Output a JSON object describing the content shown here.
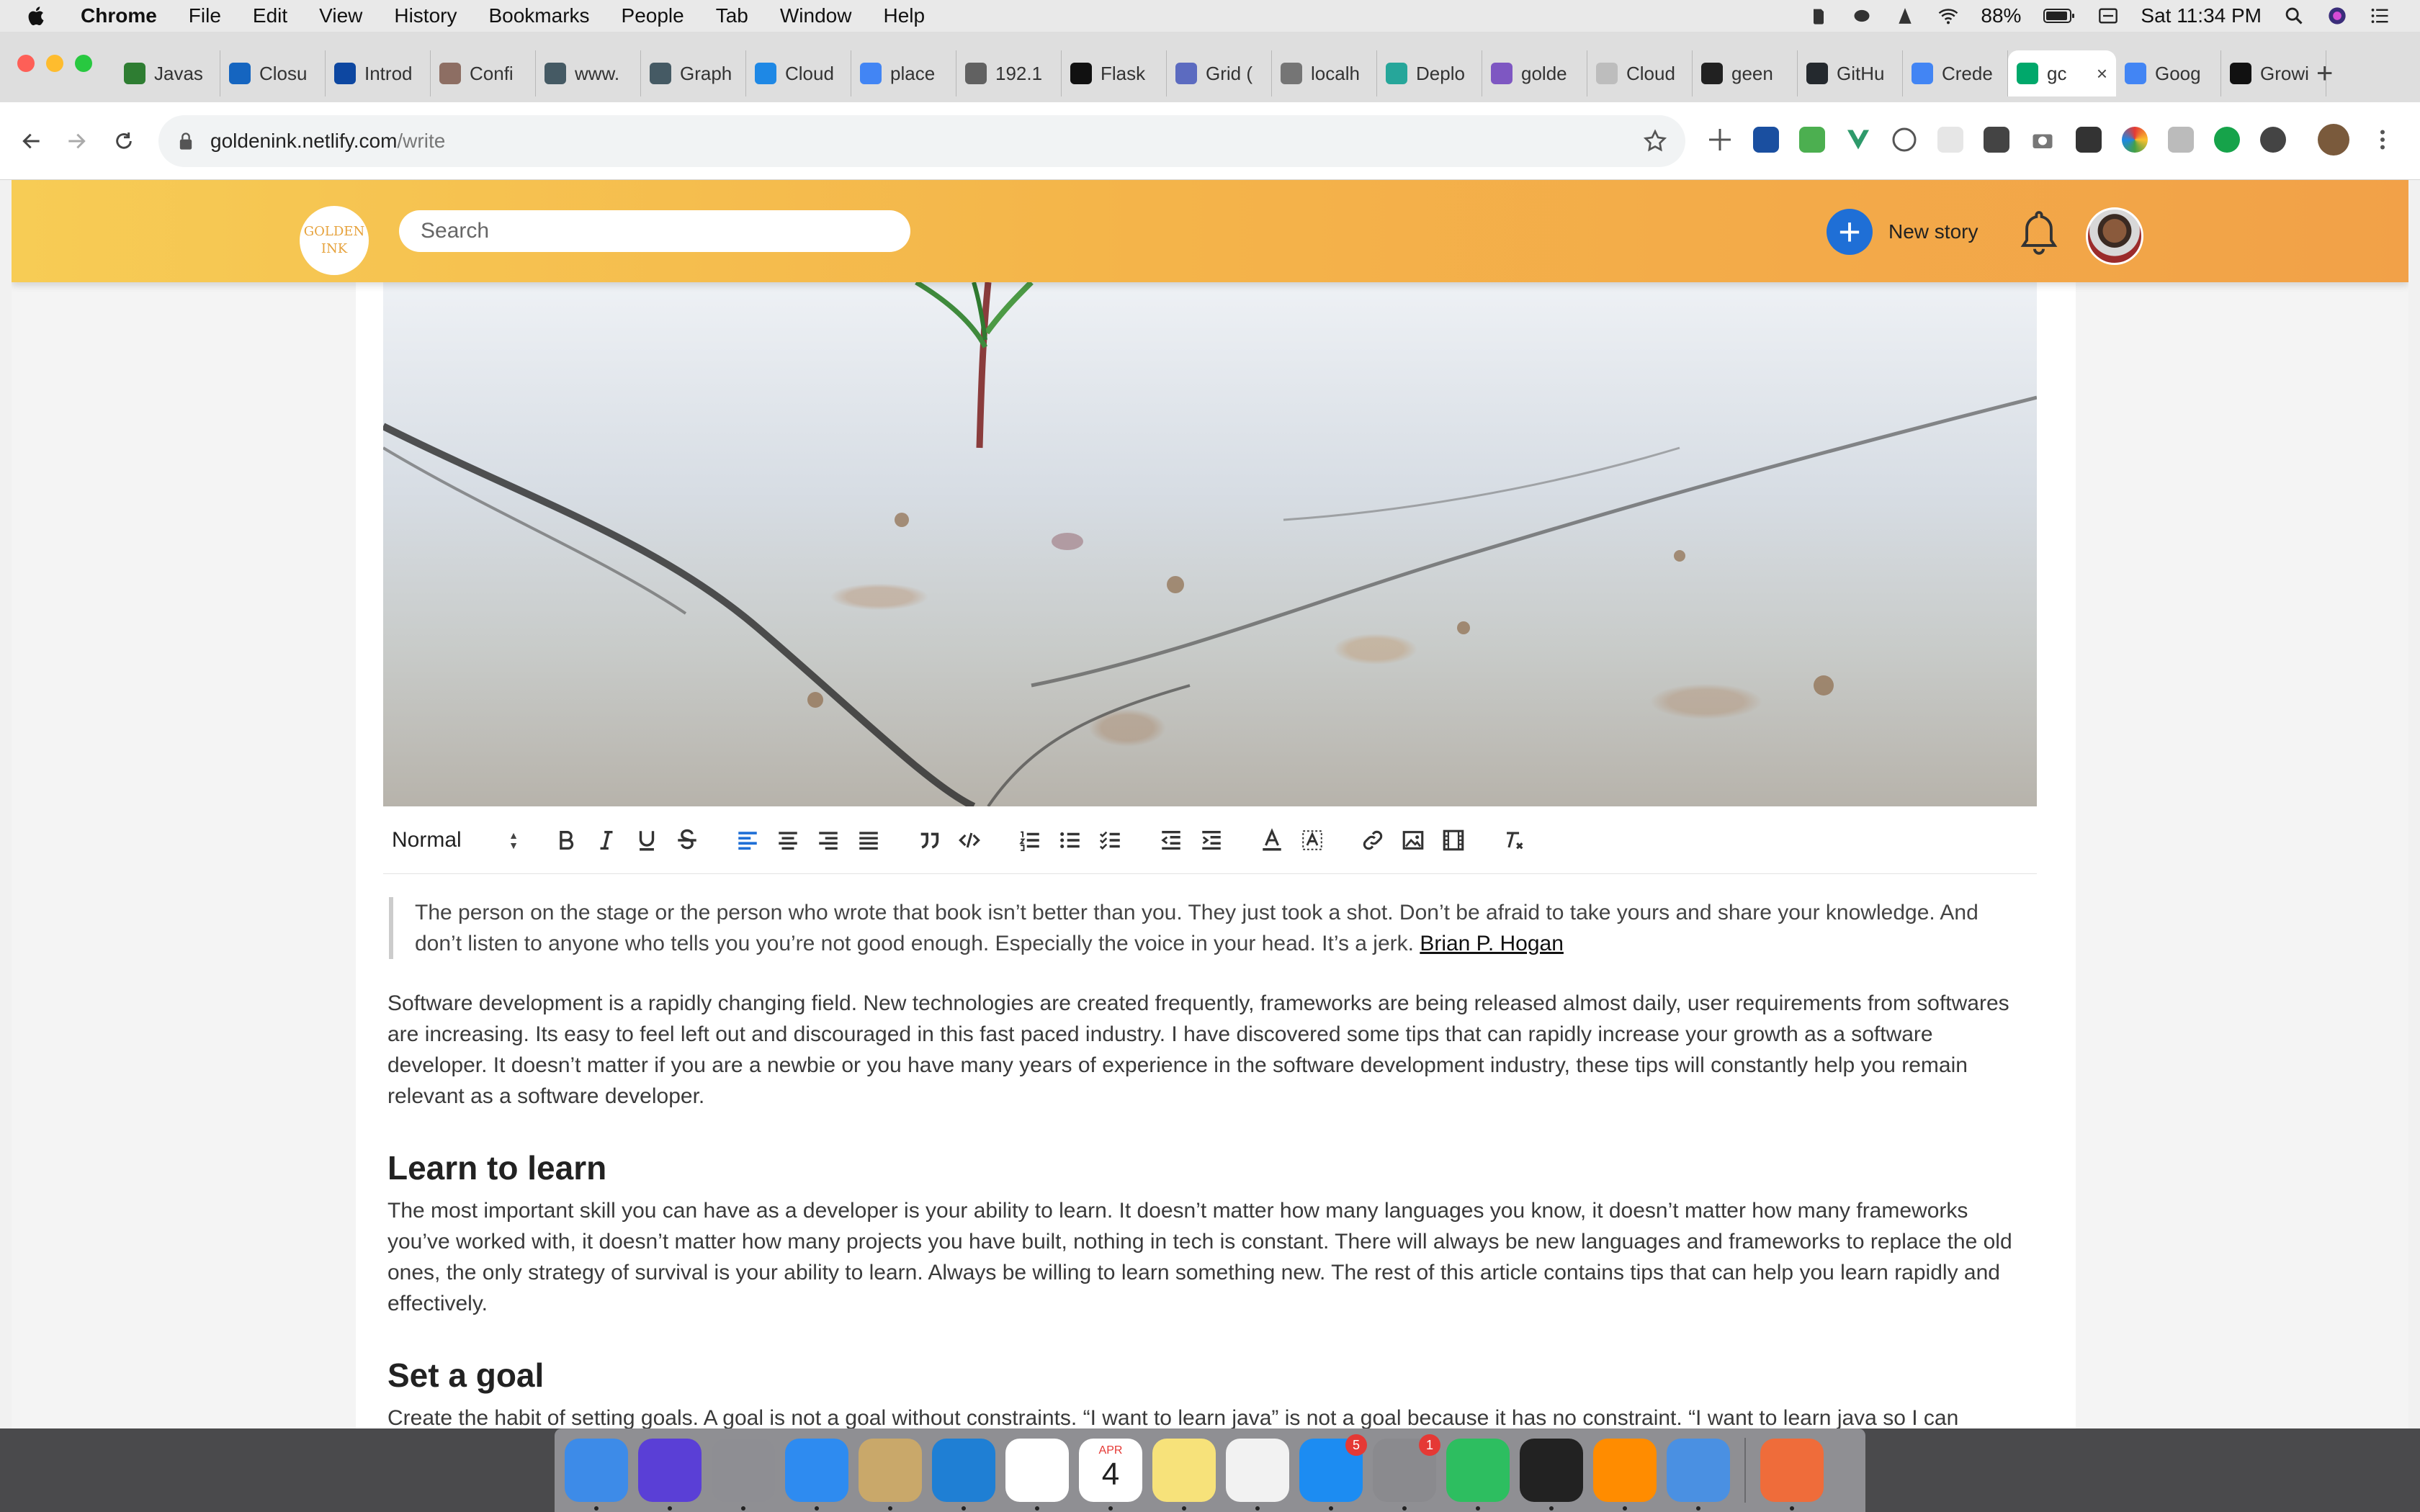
{
  "menubar": {
    "items": [
      "Chrome",
      "File",
      "Edit",
      "View",
      "History",
      "Bookmarks",
      "People",
      "Tab",
      "Window",
      "Help"
    ],
    "battery": "88%",
    "clock": "Sat 11:34 PM"
  },
  "tabs": [
    {
      "label": "Javas",
      "icon": "code-logo-icon",
      "color": "#2e7d32"
    },
    {
      "label": "Closu",
      "icon": "closure-icon",
      "color": "#1565c0"
    },
    {
      "label": "Introd",
      "icon": "intro-icon",
      "color": "#0d47a1"
    },
    {
      "label": "Confi",
      "icon": "fox-icon",
      "color": "#8d6e63"
    },
    {
      "label": "www.",
      "icon": "droplet-icon",
      "color": "#455a64"
    },
    {
      "label": "Graph",
      "icon": "droplet-icon",
      "color": "#455a64"
    },
    {
      "label": "Cloud",
      "icon": "cloud-house-icon",
      "color": "#1e88e5"
    },
    {
      "label": "place",
      "icon": "google-icon",
      "color": "#4285f4"
    },
    {
      "label": "192.1",
      "icon": "globe-icon",
      "color": "#616161"
    },
    {
      "label": "Flask",
      "icon": "dev-icon",
      "color": "#111111"
    },
    {
      "label": "Grid (",
      "icon": "wave-icon",
      "color": "#5c6bc0"
    },
    {
      "label": "localh",
      "icon": "v-icon",
      "color": "#757575"
    },
    {
      "label": "Deplo",
      "icon": "diamond-icon",
      "color": "#26a69a"
    },
    {
      "label": "golde",
      "icon": "h-icon",
      "color": "#7e57c2"
    },
    {
      "label": "Cloud",
      "icon": "cloud-icon",
      "color": "#bdbdbd"
    },
    {
      "label": "geen",
      "icon": "doc-icon",
      "color": "#212121"
    },
    {
      "label": "GitHu",
      "icon": "github-icon",
      "color": "#24292e"
    },
    {
      "label": "Crede",
      "icon": "google-icon",
      "color": "#4285f4"
    },
    {
      "label": "gc",
      "icon": "v-icon",
      "color": "#00a86b",
      "active": true
    },
    {
      "label": "Goog",
      "icon": "google-icon",
      "color": "#4285f4"
    },
    {
      "label": "Growi",
      "icon": "grow-icon",
      "color": "#111111"
    }
  ],
  "address": {
    "host": "goldenink.netlify.com",
    "path": "/write"
  },
  "app": {
    "logo_line1": "GOLDEN",
    "logo_line2": "INK",
    "search_placeholder": "Search",
    "new_story": "New story"
  },
  "editor_toolbar": {
    "format": "Normal"
  },
  "article": {
    "quote": "The person on the stage or the person who wrote that book isn’t better than you. They just took a shot. Don’t be afraid to take yours and share your knowledge. And don’t listen to anyone who tells you you’re not good enough. Especially the voice in your head. It’s a jerk. ",
    "quote_author": "Brian P. Hogan",
    "intro": "Software development is a rapidly changing field. New technologies are created frequently, frameworks are being released almost daily, user requirements from softwares are increasing. Its easy to feel left out and discouraged in this fast paced industry. I have discovered some tips that can rapidly increase your growth as a software developer. It doesn’t matter if you are a newbie or you have many years of experience in the software development industry, these tips will constantly help you remain relevant as a software developer.",
    "h_learn": "Learn to learn",
    "p_learn": "The most important skill you can have as a developer is your ability to learn. It doesn’t matter how many languages you know, it doesn’t matter how many frameworks you’ve worked with, it doesn’t matter how many projects you have built, nothing in tech is constant. There will always be new languages and frameworks to replace the old ones, the only strategy of survival is your ability to learn. Always be willing to learn something new. The rest of this article contains tips that can help you learn rapidly and effectively.",
    "h_goal": "Set a goal",
    "p_goal": "Create the habit of setting goals. A goal is not a goal without constraints. “I want to learn java” is not a goal because it has no constraint. “I want to learn java so I can develop XYZ software” or “I want to learn java for my school project” is a goal. A goal should be definite and must have a constraint. Set a goal, make a plan, write it down, set a"
  },
  "dock": {
    "apps": [
      {
        "name": "finder-icon",
        "color": "#3d8be8"
      },
      {
        "name": "siri-icon",
        "color": "#5a3fd6"
      },
      {
        "name": "launchpad-icon",
        "color": "#8e8e93"
      },
      {
        "name": "safari-icon",
        "color": "#2e8bf0"
      },
      {
        "name": "preview-icon",
        "color": "#c9a86a"
      },
      {
        "name": "vscode-icon",
        "color": "#1f7fd4"
      },
      {
        "name": "chrome-icon",
        "color": "#ffffff"
      },
      {
        "name": "calendar-icon",
        "color": "#ffffff"
      },
      {
        "name": "notes-icon",
        "color": "#f7e27a"
      },
      {
        "name": "music-icon",
        "color": "#f2f2f2"
      },
      {
        "name": "appstore-icon",
        "color": "#1c8cf2",
        "badge": "5"
      },
      {
        "name": "system-preferences-icon",
        "color": "#8a8a8e",
        "badge": "1"
      },
      {
        "name": "evernote-icon",
        "color": "#2dbe60"
      },
      {
        "name": "terminal-icon",
        "color": "#222222"
      },
      {
        "name": "vlc-icon",
        "color": "#ff8c00"
      },
      {
        "name": "tableplus-icon",
        "color": "#4a90e2"
      },
      {
        "name": "postman-icon",
        "color": "#ef6c3a"
      }
    ],
    "calendar_month": "APR",
    "calendar_day": "4"
  },
  "colors": {
    "brand_gradient_start": "#f7cc55",
    "brand_gradient_end": "#f2a148",
    "accent_blue": "#1f6fd6"
  }
}
